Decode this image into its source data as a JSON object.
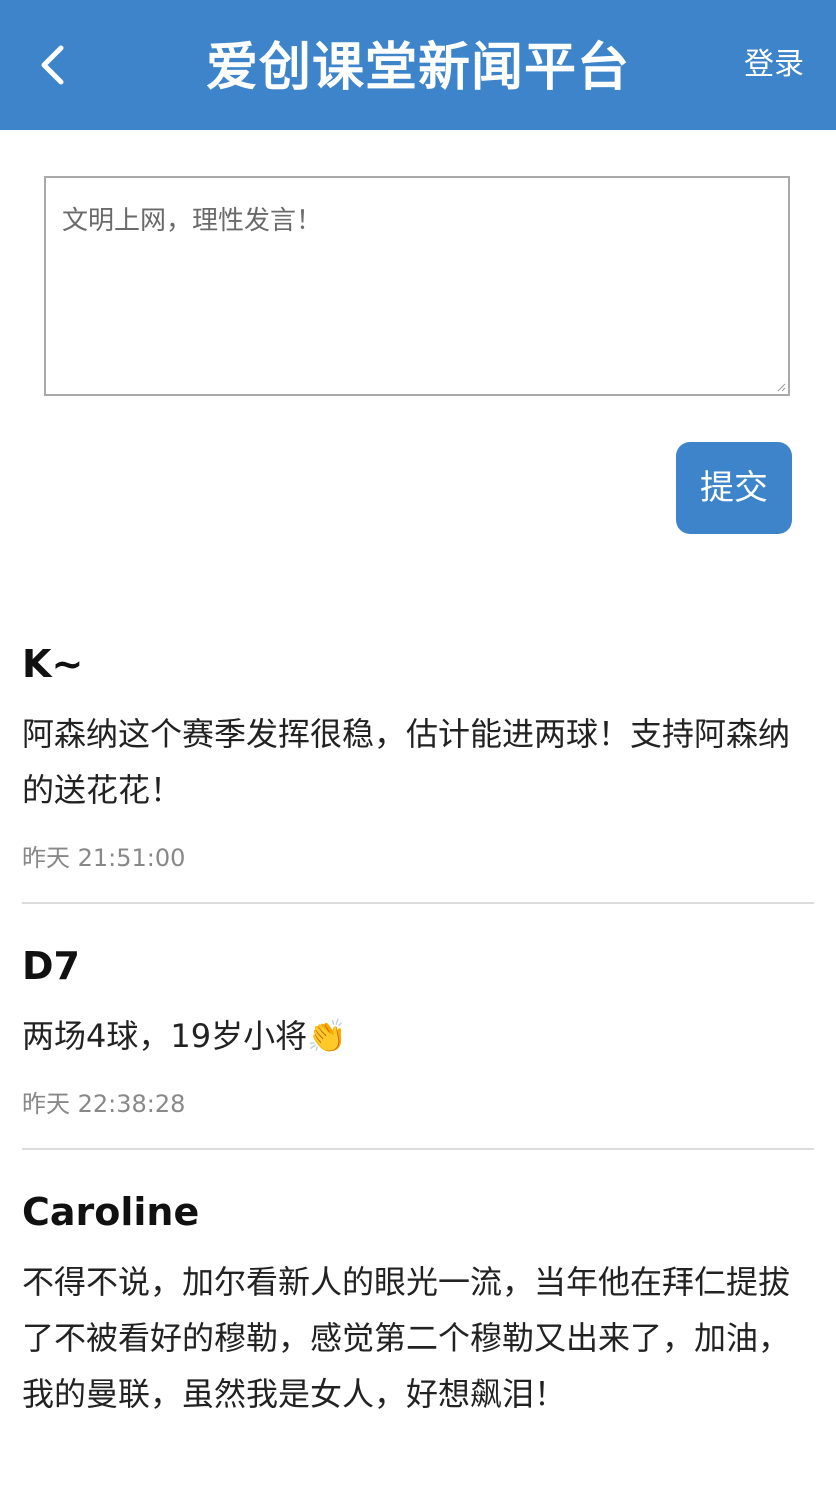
{
  "header": {
    "title": "爱创课堂新闻平台",
    "login_label": "登录",
    "back_icon": "chevron-left-icon"
  },
  "composer": {
    "placeholder": "文明上网，理性发言！",
    "value": "",
    "submit_label": "提交"
  },
  "comments": [
    {
      "author": "K~",
      "content": "阿森纳这个赛季发挥很稳，估计能进两球！支持阿森纳的送花花！",
      "time": "昨天 21:51:00"
    },
    {
      "author": "D7",
      "content": "两场4球，19岁小将👏",
      "time": "昨天 22:38:28"
    },
    {
      "author": "Caroline",
      "content": "不得不说，加尔看新人的眼光一流，当年他在拜仁提拔了不被看好的穆勒，感觉第二个穆勒又出来了，加油，我的曼联，虽然我是女人，好想飙泪！",
      "time": ""
    }
  ],
  "colors": {
    "primary": "#3d84ca",
    "divider": "#dcdcdc",
    "muted_text": "#888888"
  }
}
